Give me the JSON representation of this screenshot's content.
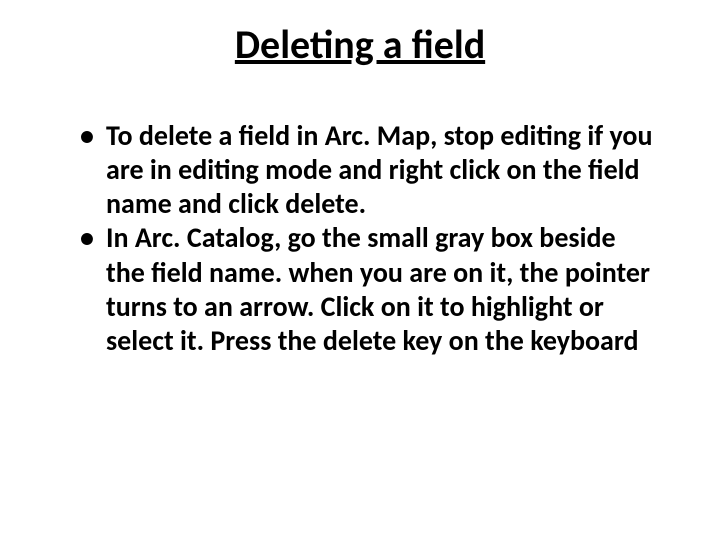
{
  "slide": {
    "title": "Deleting a field",
    "bullets": [
      "To delete a field in Arc. Map, stop editing if you are in editing mode and right click on the field name and click delete.",
      "In Arc. Catalog, go the small gray box beside the field name. when you are on it, the pointer turns to an arrow. Click on it to highlight or select it. Press the delete key on the keyboard"
    ]
  }
}
